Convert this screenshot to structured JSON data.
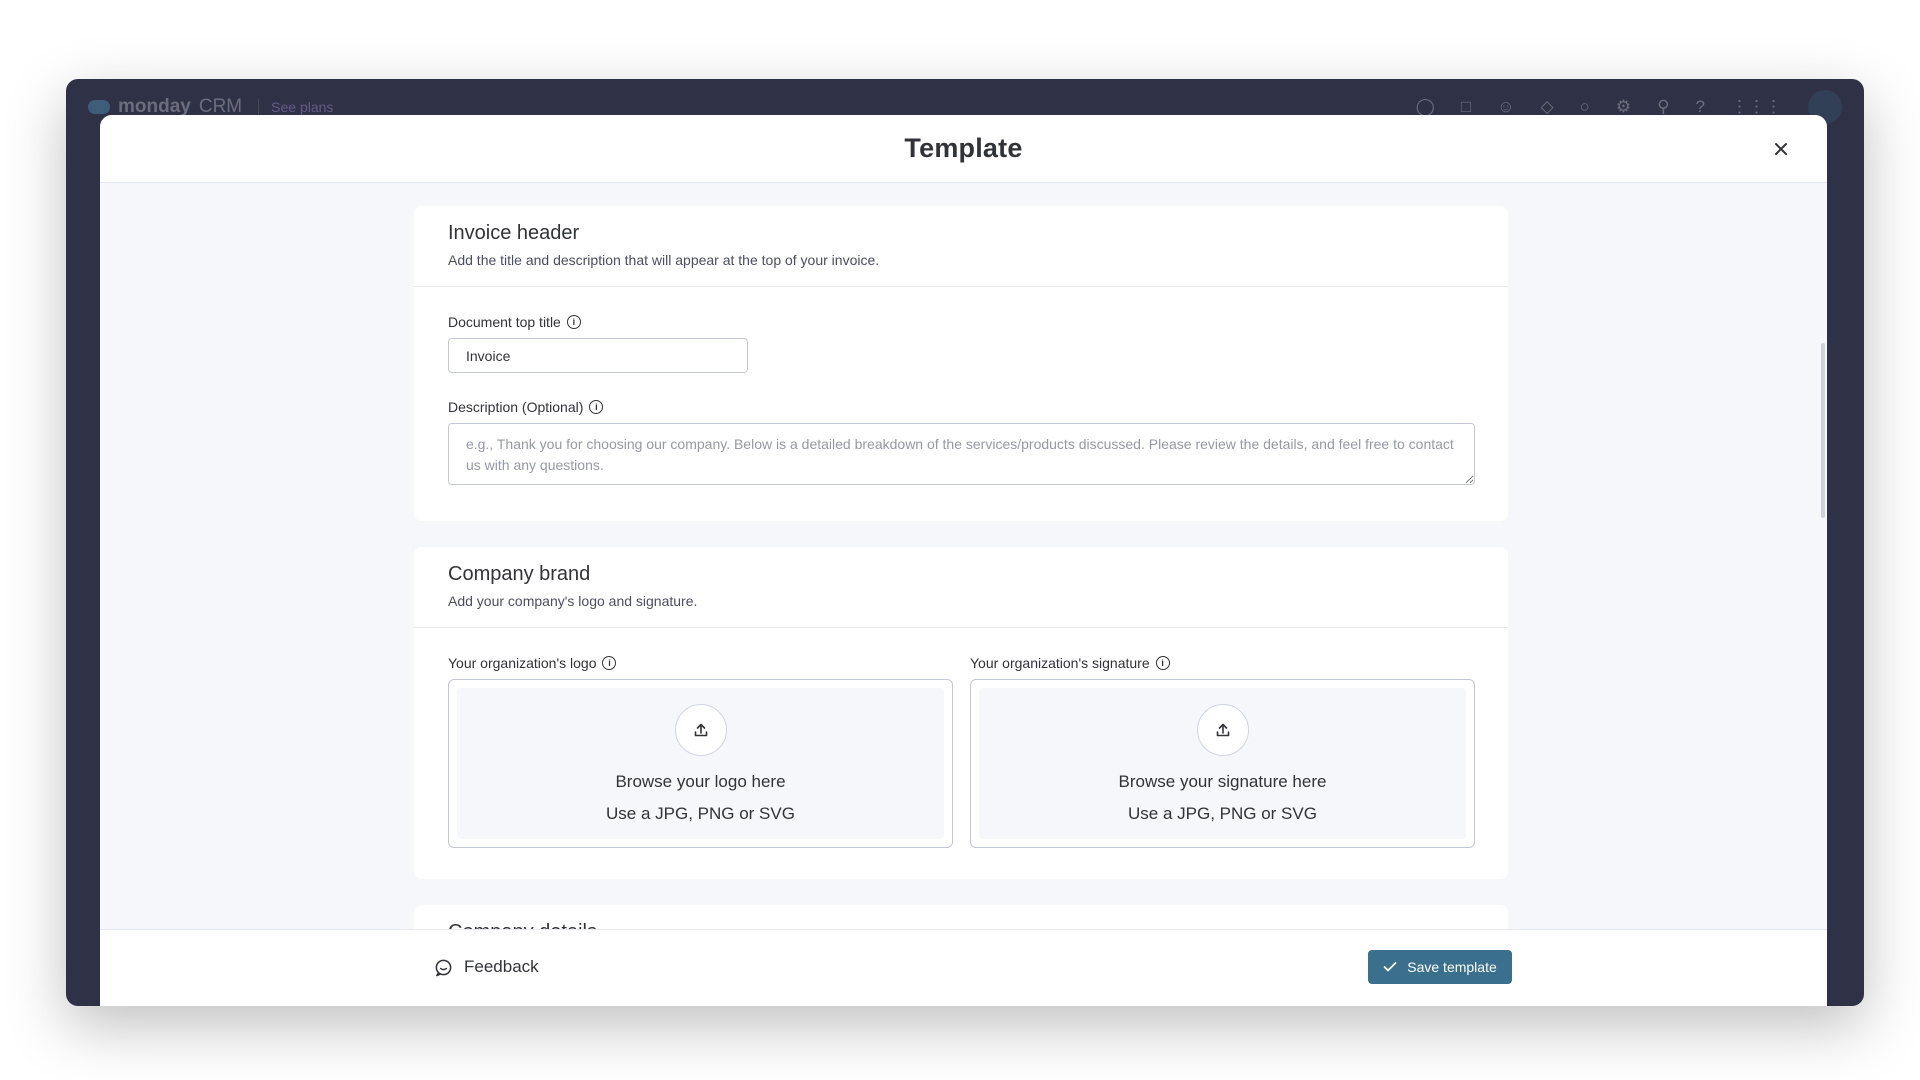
{
  "app": {
    "logo_name": "monday",
    "logo_suffix": "CRM",
    "plans_label": "See plans"
  },
  "modal": {
    "title": "Template",
    "close_label": "×"
  },
  "invoice_header": {
    "title": "Invoice header",
    "subtitle": "Add the title and description that will appear at the top of your invoice.",
    "doc_title_label": "Document top title",
    "doc_title_value": "Invoice",
    "description_label": "Description (Optional)",
    "description_placeholder": "e.g., Thank you for choosing our company. Below is a detailed breakdown of the services/products discussed. Please review the details, and feel free to contact us with any questions."
  },
  "company_brand": {
    "title": "Company brand",
    "subtitle": "Add your company's logo and signature.",
    "logo_label": "Your organization's logo",
    "logo_browse": "Browse your logo here",
    "logo_formats": "Use a JPG, PNG or SVG",
    "signature_label": "Your organization's signature",
    "signature_browse": "Browse your signature here",
    "signature_formats": "Use a JPG, PNG or SVG"
  },
  "next_section": {
    "title": "Company details"
  },
  "footer": {
    "feedback_label": "Feedback",
    "save_label": "Save template"
  },
  "colors": {
    "primary": "#3a6f8e",
    "background": "#f6f7fb",
    "app_dark": "#2f3146"
  }
}
